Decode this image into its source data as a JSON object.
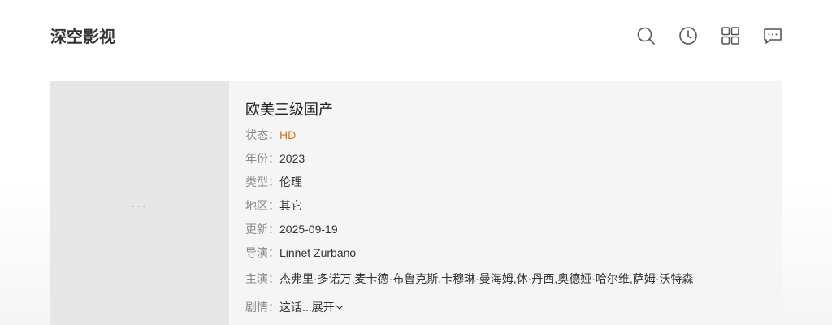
{
  "site": {
    "logo": "深空影视"
  },
  "header": {
    "icons": [
      "search-icon",
      "history-icon",
      "grid-icon",
      "message-icon"
    ]
  },
  "poster": {
    "loading_text": "..."
  },
  "movie": {
    "title": "欧美三级国产",
    "fields": [
      {
        "label": "状态：",
        "value": "HD"
      },
      {
        "label": "年份：",
        "value": "2023"
      },
      {
        "label": "类型：",
        "value": "伦理"
      },
      {
        "label": "地区：",
        "value": "其它"
      },
      {
        "label": "更新：",
        "value": "2025-09-19"
      },
      {
        "label": "导演：",
        "value": "Linnet Zurbano"
      },
      {
        "label": "主演：",
        "value": "杰弗里·多诺万,麦卡德·布鲁克斯,卡穆琳·曼海姆,休·丹西,奥德娅·哈尔维,萨姆·沃特森"
      }
    ],
    "plot": {
      "label": "剧情：",
      "value": "这话...",
      "expand_label": "展开"
    }
  },
  "colors": {
    "accent": "#e66d1b",
    "label": "#888888",
    "panel": "#f5f5f5",
    "poster": "#e6e6e6"
  }
}
